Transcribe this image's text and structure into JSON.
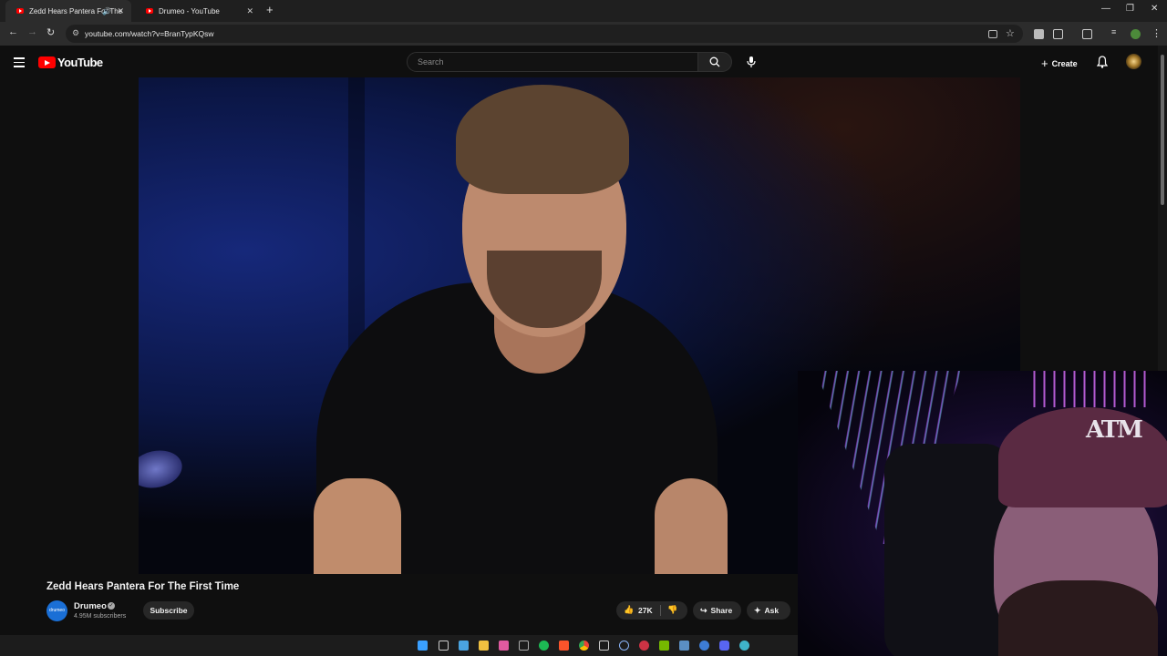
{
  "browser": {
    "tabs": [
      {
        "title": "Zedd Hears Pantera For The",
        "active": true,
        "audio": true
      },
      {
        "title": "Drumeo - YouTube",
        "active": false,
        "audio": false
      }
    ],
    "new_tab_icon": "plus-icon",
    "url": "youtube.com/watch?v=BranTypKQsw"
  },
  "youtube": {
    "logo_text": "YouTube",
    "search": {
      "placeholder": "Search",
      "value": ""
    },
    "create_label": "Create"
  },
  "video": {
    "title": "Zedd Hears Pantera For The First Time",
    "channel": {
      "name": "Drumeo",
      "avatar_text": "drumeo",
      "subscribers": "4.95M subscribers",
      "verified": true
    },
    "subscribe_label": "Subscribe",
    "likes": "27K",
    "share_label": "Share",
    "ask_label": "Ask"
  },
  "colors": {
    "youtube_red": "#ff0000",
    "background": "#0f0f0f",
    "pill_bg": "#272727",
    "channel_avatar": "#1a6fd6"
  }
}
